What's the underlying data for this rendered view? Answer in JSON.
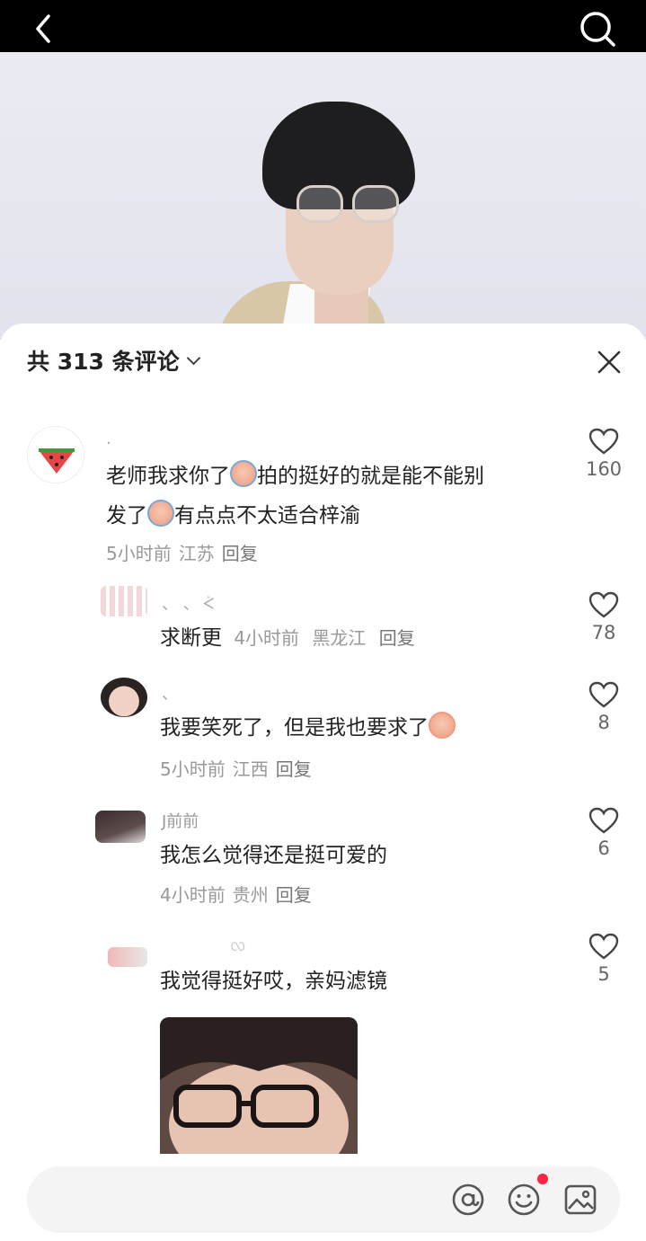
{
  "header": {
    "comment_count_label": "共 313 条评论"
  },
  "comments": [
    {
      "username": ".",
      "text_parts": [
        "老师我求你了",
        "拍的挺好的就是能不能别",
        "发了",
        "有点点不太适合梓渝"
      ],
      "time": "5小时前",
      "location": "江苏",
      "reply": "回复",
      "likes": "160"
    },
    {
      "username": "、 、 ᢵ",
      "text": "求断更",
      "time": "4小时前",
      "location": "黑龙江",
      "reply": "回复",
      "likes": "78"
    },
    {
      "username": "、",
      "text": "我要笑死了，但是我也要求了",
      "time": "5小时前",
      "location": "江西",
      "reply": "回复",
      "likes": "8"
    },
    {
      "username": "J前前",
      "text": "我怎么觉得还是挺可爱的",
      "time": "4小时前",
      "location": "贵州",
      "reply": "回复",
      "likes": "6"
    },
    {
      "username": "ᩃ",
      "text": "我觉得挺好哎，亲妈滤镜",
      "likes": "5"
    }
  ],
  "input": {
    "placeholder": ""
  },
  "icons": [
    "back-icon",
    "search-icon",
    "close-icon",
    "heart-icon",
    "at-icon",
    "smile-icon",
    "image-icon"
  ],
  "colors": {
    "topbar": "#000000",
    "badge": "#ff2442",
    "text": "#222222",
    "meta": "#999999"
  }
}
